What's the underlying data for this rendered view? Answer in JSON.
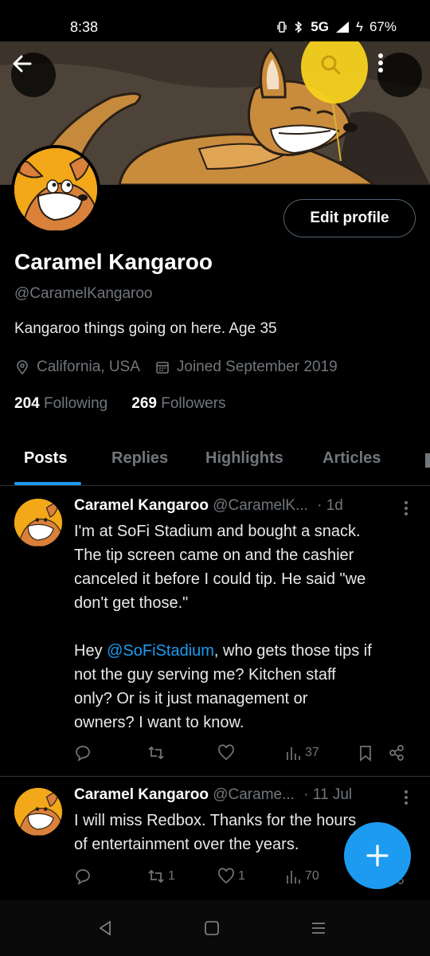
{
  "status": {
    "time": "8:38",
    "network": "5G",
    "battery": "67%"
  },
  "profile": {
    "name": "Caramel Kangaroo",
    "handle": "@CaramelKangaroo",
    "bio": "Kangaroo things going on here. Age 35",
    "location": "California, USA",
    "joined": "Joined September 2019",
    "following_count": "204",
    "following_label": "Following",
    "followers_count": "269",
    "followers_label": "Followers",
    "edit_label": "Edit profile"
  },
  "tabs": [
    "Posts",
    "Replies",
    "Highlights",
    "Articles",
    ""
  ],
  "posts": [
    {
      "name": "Caramel Kangaroo",
      "handle": "@CaramelK...",
      "time": "· 1d",
      "lines": [
        "I'm at SoFi Stadium and bought a snack.",
        "The tip screen came on and the cashier",
        "canceled it before I could tip. He said \"we",
        "don't get those.\""
      ],
      "line5_pre": "Hey ",
      "line5_link": "@SoFiStadium",
      "line5_post": ", who gets those tips if",
      "lines2": [
        "not the guy serving me? Kitchen staff",
        "only? Or is it just management or",
        "owners? I want to know."
      ],
      "views": "37",
      "reposts": "",
      "likes": ""
    },
    {
      "name": "Caramel Kangaroo",
      "handle": "@Carame...",
      "time": "· 11 Jul",
      "lines": [
        "I will miss Redbox. Thanks for the hours",
        "of entertainment over the years."
      ],
      "views": "70",
      "reposts": "1",
      "likes": "1"
    }
  ],
  "colors": {
    "accent": "#1d9bf0",
    "muted": "#71767b",
    "background": "#000000"
  }
}
